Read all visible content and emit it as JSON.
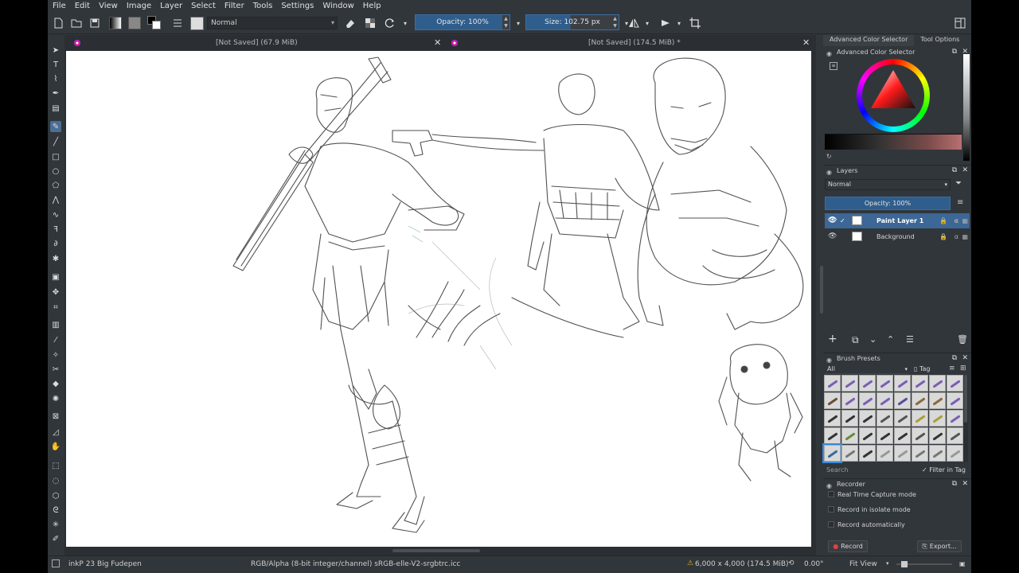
{
  "menu": [
    "File",
    "Edit",
    "View",
    "Image",
    "Layer",
    "Select",
    "Filter",
    "Tools",
    "Settings",
    "Window",
    "Help"
  ],
  "toolbar": {
    "blend_mode": "Normal",
    "opacity_label": "Opacity: 100%",
    "size_label": "Size: 102.75 px"
  },
  "documents": [
    {
      "title": "[Not Saved]  (67.9 MiB)"
    },
    {
      "title": "[Not Saved]  (174.5 MiB) *"
    }
  ],
  "docker": {
    "tabs": [
      "Advanced Color Selector",
      "Tool Options"
    ],
    "color_selector_title": "Advanced Color Selector",
    "layers_title": "Layers",
    "layers_blend": "Normal",
    "layers_opacity": "Opacity: 100%",
    "layers": [
      {
        "name": "Paint Layer 1",
        "selected": true
      },
      {
        "name": "Background",
        "selected": false
      }
    ],
    "brush_presets_title": "Brush Presets",
    "brush_filter": "All",
    "brush_tag": "Tag",
    "brush_search_placeholder": "Search",
    "filter_in_tag": "Filter in Tag",
    "recorder_title": "Recorder",
    "recorder_options": [
      "Real Time Capture mode",
      "Record in isolate mode",
      "Record automatically"
    ],
    "record_button": "Record",
    "export_button": "Export..."
  },
  "status": {
    "brush_name": "inkP 23 Big Fudepen",
    "color_profile": "RGB/Alpha (8-bit integer/channel)  sRGB-elle-V2-srgbtrc.icc",
    "image_size": "6,000 x 4,000 (174.5 MiB)",
    "rotation": "0.00°",
    "zoom": "Fit View"
  },
  "colors": {
    "accent": "#2f5d8c",
    "selection": "#3c6796",
    "background": "#31363b"
  }
}
